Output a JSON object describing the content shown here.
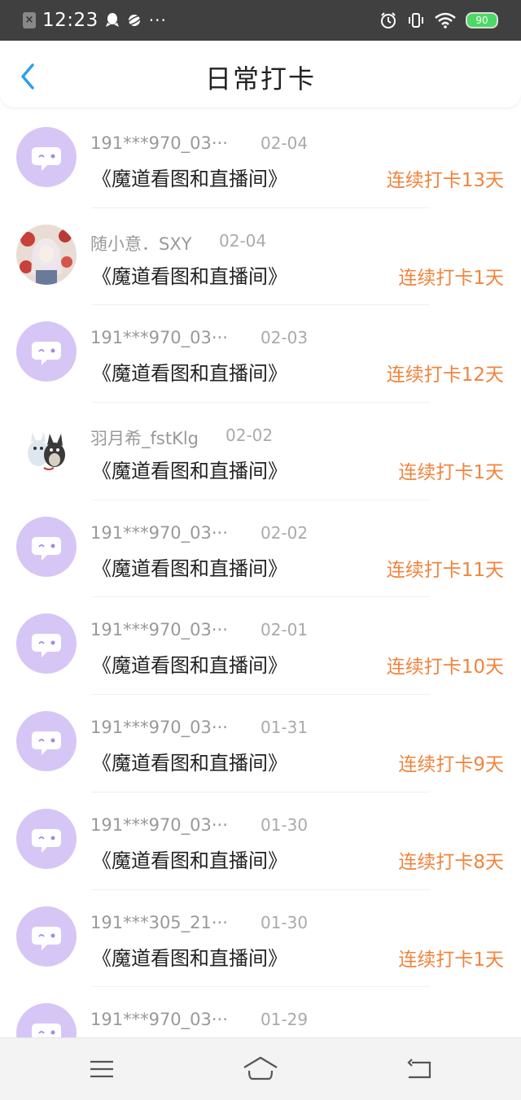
{
  "status_bar": {
    "time": "12:23",
    "more": "···",
    "battery": "90",
    "icons": [
      "close-icon",
      "qq-icon",
      "planet-icon",
      "alarm-icon",
      "vibrate-icon",
      "wifi-icon",
      "battery-icon"
    ]
  },
  "header": {
    "title": "日常打卡",
    "back_icon": "chevron-left-icon"
  },
  "colors": {
    "accent_blue": "#2d9ff0",
    "streak_orange": "#f0843c",
    "avatar_bubble": "#d6c6f6"
  },
  "checkins": [
    {
      "user": "191***970_03···",
      "date": "02-04",
      "book": "《魔道看图和直播间》",
      "streak": "连续打卡13天",
      "avatar": "chat-bubble-icon"
    },
    {
      "user": "随小意．SXY",
      "date": "02-04",
      "book": "《魔道看图和直播间》",
      "streak": "连续打卡1天",
      "avatar": "anime-girl-photo"
    },
    {
      "user": "191***970_03···",
      "date": "02-03",
      "book": "《魔道看图和直播间》",
      "streak": "连续打卡12天",
      "avatar": "chat-bubble-icon"
    },
    {
      "user": "羽月希_fstKlg",
      "date": "02-02",
      "book": "《魔道看图和直播间》",
      "streak": "连续打卡1天",
      "avatar": "totoro-photo"
    },
    {
      "user": "191***970_03···",
      "date": "02-02",
      "book": "《魔道看图和直播间》",
      "streak": "连续打卡11天",
      "avatar": "chat-bubble-icon"
    },
    {
      "user": "191***970_03···",
      "date": "02-01",
      "book": "《魔道看图和直播间》",
      "streak": "连续打卡10天",
      "avatar": "chat-bubble-icon"
    },
    {
      "user": "191***970_03···",
      "date": "01-31",
      "book": "《魔道看图和直播间》",
      "streak": "连续打卡9天",
      "avatar": "chat-bubble-icon"
    },
    {
      "user": "191***970_03···",
      "date": "01-30",
      "book": "《魔道看图和直播间》",
      "streak": "连续打卡8天",
      "avatar": "chat-bubble-icon"
    },
    {
      "user": "191***305_21···",
      "date": "01-30",
      "book": "《魔道看图和直播间》",
      "streak": "连续打卡1天",
      "avatar": "chat-bubble-icon"
    },
    {
      "user": "191***970_03···",
      "date": "01-29",
      "book": "",
      "streak": "",
      "avatar": "chat-bubble-icon"
    }
  ],
  "nav_bar": {
    "icons": [
      "menu-icon",
      "home-icon",
      "back-icon"
    ]
  }
}
